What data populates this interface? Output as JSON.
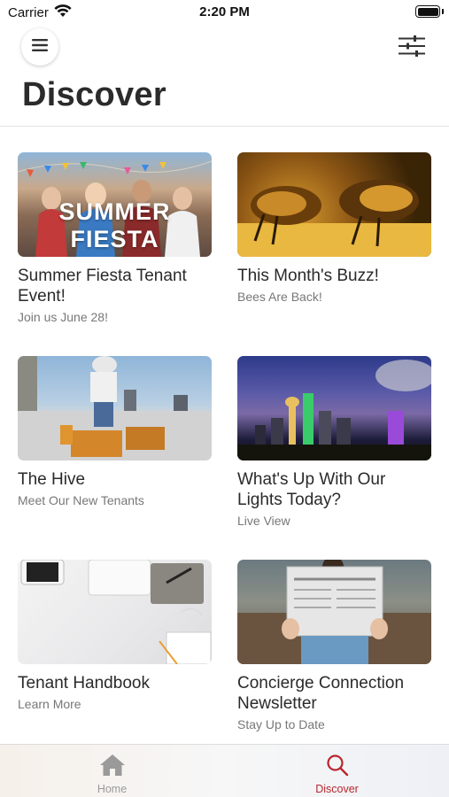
{
  "status_bar": {
    "carrier": "Carrier",
    "time": "2:20 PM"
  },
  "header": {
    "title": "Discover"
  },
  "cards": [
    {
      "title": "Summer Fiesta Tenant Event!",
      "subtitle": "Join us June 28!",
      "image_text": "SUMMER FIESTA"
    },
    {
      "title": "This Month's Buzz!",
      "subtitle": "Bees Are Back!"
    },
    {
      "title": "The Hive",
      "subtitle": "Meet Our New Tenants"
    },
    {
      "title": "What's Up With Our Lights Today?",
      "subtitle": "Live View"
    },
    {
      "title": "Tenant Handbook",
      "subtitle": "Learn More"
    },
    {
      "title": "Concierge Connection Newsletter",
      "subtitle": "Stay Up to Date"
    }
  ],
  "tab_bar": {
    "tabs": [
      {
        "label": "Home",
        "icon": "home-icon",
        "active": false
      },
      {
        "label": "Discover",
        "icon": "search-icon",
        "active": true
      }
    ],
    "active_color": "#b8262e",
    "inactive_color": "#9a9a9a"
  }
}
